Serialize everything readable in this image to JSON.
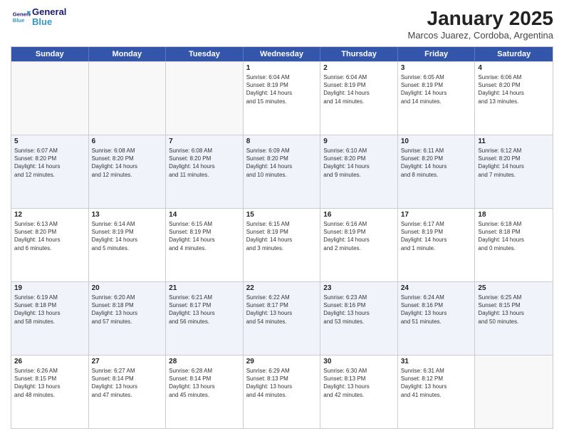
{
  "header": {
    "logo_general": "General",
    "logo_blue": "Blue",
    "title": "January 2025",
    "subtitle": "Marcos Juarez, Cordoba, Argentina"
  },
  "days_of_week": [
    "Sunday",
    "Monday",
    "Tuesday",
    "Wednesday",
    "Thursday",
    "Friday",
    "Saturday"
  ],
  "weeks": [
    [
      {
        "day": "",
        "info": ""
      },
      {
        "day": "",
        "info": ""
      },
      {
        "day": "",
        "info": ""
      },
      {
        "day": "1",
        "info": "Sunrise: 6:04 AM\nSunset: 8:19 PM\nDaylight: 14 hours\nand 15 minutes."
      },
      {
        "day": "2",
        "info": "Sunrise: 6:04 AM\nSunset: 8:19 PM\nDaylight: 14 hours\nand 14 minutes."
      },
      {
        "day": "3",
        "info": "Sunrise: 6:05 AM\nSunset: 8:19 PM\nDaylight: 14 hours\nand 14 minutes."
      },
      {
        "day": "4",
        "info": "Sunrise: 6:06 AM\nSunset: 8:20 PM\nDaylight: 14 hours\nand 13 minutes."
      }
    ],
    [
      {
        "day": "5",
        "info": "Sunrise: 6:07 AM\nSunset: 8:20 PM\nDaylight: 14 hours\nand 12 minutes."
      },
      {
        "day": "6",
        "info": "Sunrise: 6:08 AM\nSunset: 8:20 PM\nDaylight: 14 hours\nand 12 minutes."
      },
      {
        "day": "7",
        "info": "Sunrise: 6:08 AM\nSunset: 8:20 PM\nDaylight: 14 hours\nand 11 minutes."
      },
      {
        "day": "8",
        "info": "Sunrise: 6:09 AM\nSunset: 8:20 PM\nDaylight: 14 hours\nand 10 minutes."
      },
      {
        "day": "9",
        "info": "Sunrise: 6:10 AM\nSunset: 8:20 PM\nDaylight: 14 hours\nand 9 minutes."
      },
      {
        "day": "10",
        "info": "Sunrise: 6:11 AM\nSunset: 8:20 PM\nDaylight: 14 hours\nand 8 minutes."
      },
      {
        "day": "11",
        "info": "Sunrise: 6:12 AM\nSunset: 8:20 PM\nDaylight: 14 hours\nand 7 minutes."
      }
    ],
    [
      {
        "day": "12",
        "info": "Sunrise: 6:13 AM\nSunset: 8:20 PM\nDaylight: 14 hours\nand 6 minutes."
      },
      {
        "day": "13",
        "info": "Sunrise: 6:14 AM\nSunset: 8:19 PM\nDaylight: 14 hours\nand 5 minutes."
      },
      {
        "day": "14",
        "info": "Sunrise: 6:15 AM\nSunset: 8:19 PM\nDaylight: 14 hours\nand 4 minutes."
      },
      {
        "day": "15",
        "info": "Sunrise: 6:15 AM\nSunset: 8:19 PM\nDaylight: 14 hours\nand 3 minutes."
      },
      {
        "day": "16",
        "info": "Sunrise: 6:16 AM\nSunset: 8:19 PM\nDaylight: 14 hours\nand 2 minutes."
      },
      {
        "day": "17",
        "info": "Sunrise: 6:17 AM\nSunset: 8:19 PM\nDaylight: 14 hours\nand 1 minute."
      },
      {
        "day": "18",
        "info": "Sunrise: 6:18 AM\nSunset: 8:18 PM\nDaylight: 14 hours\nand 0 minutes."
      }
    ],
    [
      {
        "day": "19",
        "info": "Sunrise: 6:19 AM\nSunset: 8:18 PM\nDaylight: 13 hours\nand 58 minutes."
      },
      {
        "day": "20",
        "info": "Sunrise: 6:20 AM\nSunset: 8:18 PM\nDaylight: 13 hours\nand 57 minutes."
      },
      {
        "day": "21",
        "info": "Sunrise: 6:21 AM\nSunset: 8:17 PM\nDaylight: 13 hours\nand 56 minutes."
      },
      {
        "day": "22",
        "info": "Sunrise: 6:22 AM\nSunset: 8:17 PM\nDaylight: 13 hours\nand 54 minutes."
      },
      {
        "day": "23",
        "info": "Sunrise: 6:23 AM\nSunset: 8:16 PM\nDaylight: 13 hours\nand 53 minutes."
      },
      {
        "day": "24",
        "info": "Sunrise: 6:24 AM\nSunset: 8:16 PM\nDaylight: 13 hours\nand 51 minutes."
      },
      {
        "day": "25",
        "info": "Sunrise: 6:25 AM\nSunset: 8:15 PM\nDaylight: 13 hours\nand 50 minutes."
      }
    ],
    [
      {
        "day": "26",
        "info": "Sunrise: 6:26 AM\nSunset: 8:15 PM\nDaylight: 13 hours\nand 48 minutes."
      },
      {
        "day": "27",
        "info": "Sunrise: 6:27 AM\nSunset: 8:14 PM\nDaylight: 13 hours\nand 47 minutes."
      },
      {
        "day": "28",
        "info": "Sunrise: 6:28 AM\nSunset: 8:14 PM\nDaylight: 13 hours\nand 45 minutes."
      },
      {
        "day": "29",
        "info": "Sunrise: 6:29 AM\nSunset: 8:13 PM\nDaylight: 13 hours\nand 44 minutes."
      },
      {
        "day": "30",
        "info": "Sunrise: 6:30 AM\nSunset: 8:13 PM\nDaylight: 13 hours\nand 42 minutes."
      },
      {
        "day": "31",
        "info": "Sunrise: 6:31 AM\nSunset: 8:12 PM\nDaylight: 13 hours\nand 41 minutes."
      },
      {
        "day": "",
        "info": ""
      }
    ]
  ],
  "alt_rows": [
    1,
    3
  ]
}
